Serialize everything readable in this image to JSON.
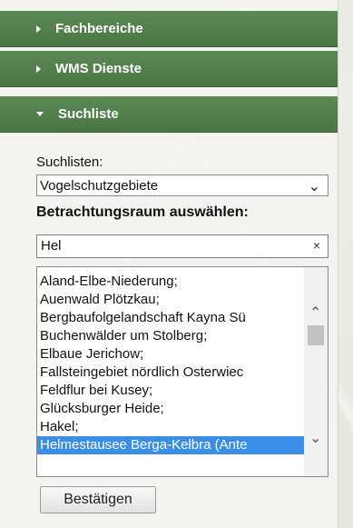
{
  "accordion": {
    "fachbereiche": "Fachbereiche",
    "wms": "WMS Dienste",
    "suchliste": "Suchliste"
  },
  "search_panel": {
    "suchlisten_label": "Suchlisten:",
    "suchlisten_value": "Vogelschutzgebiete",
    "betrachtungsraum_label": "Betrachtungsraum auswählen:",
    "search_value": "Hel",
    "clear_symbol": "×",
    "results": [
      "Aland-Elbe-Niederung;",
      "Auenwald Plötzkau;",
      "Bergbaufolgelandschaft Kayna Sü",
      "Buchenwälder um Stolberg;",
      "Elbaue Jerichow;",
      "Fallsteingebiet nördlich Osterwiec",
      "Feldflur bei Kusey;",
      "Glücksburger Heide;",
      "Hakel;",
      "Helmestausee Berga-Kelbra (Ante"
    ],
    "selected_index": 9,
    "confirm_label": "Bestätigen"
  },
  "colors": {
    "accordion_green": "#4a7644",
    "selection_blue": "#3a8ee6"
  }
}
